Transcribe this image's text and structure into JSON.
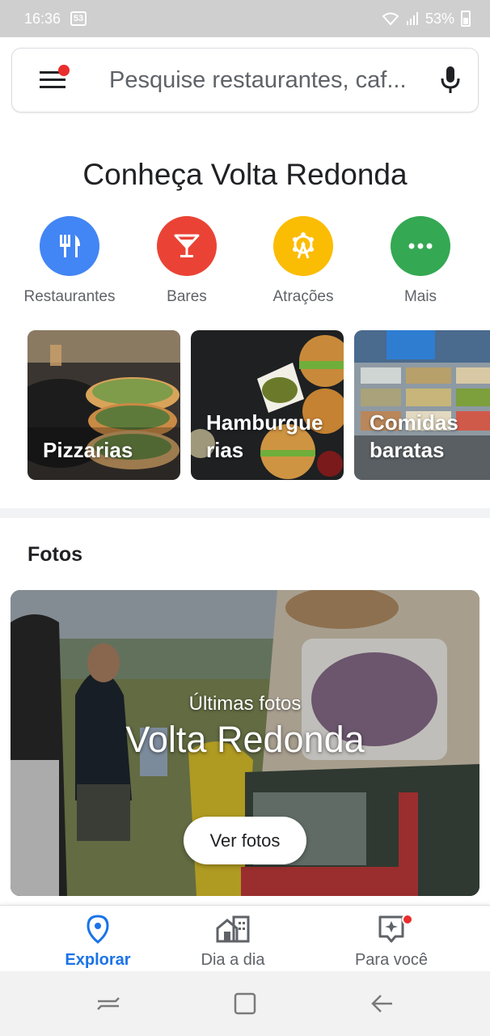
{
  "status_bar": {
    "time": "16:36",
    "notif_count": "53",
    "battery": "53%"
  },
  "search": {
    "placeholder": "Pesquise restaurantes, caf..."
  },
  "heading": "Conheça Volta Redonda",
  "categories": [
    {
      "label": "Restaurantes",
      "icon": "fork-knife-icon",
      "color": "#4285f4"
    },
    {
      "label": "Bares",
      "icon": "cocktail-icon",
      "color": "#ea4335"
    },
    {
      "label": "Atrações",
      "icon": "ferris-wheel-icon",
      "color": "#fbbc04"
    },
    {
      "label": "Mais",
      "icon": "more-horiz-icon",
      "color": "#34a853"
    }
  ],
  "cards": [
    {
      "label_line1": "Pizzarias",
      "label_line2": ""
    },
    {
      "label_line1": "Hamburgue",
      "label_line2": "rias"
    },
    {
      "label_line1": "Comidas",
      "label_line2": "baratas"
    }
  ],
  "photos_section": {
    "title": "Fotos",
    "subtitle": "Últimas fotos",
    "place": "Volta Redonda",
    "button": "Ver fotos"
  },
  "bottom_nav": [
    {
      "label": "Explorar",
      "icon": "location-pin-icon",
      "active": true
    },
    {
      "label": "Dia a dia",
      "icon": "commute-icon",
      "active": false
    },
    {
      "label": "Para você",
      "icon": "sparkle-icon",
      "active": false
    }
  ],
  "colors": {
    "accent": "#1a73e8",
    "notification": "#ea2d2d"
  }
}
